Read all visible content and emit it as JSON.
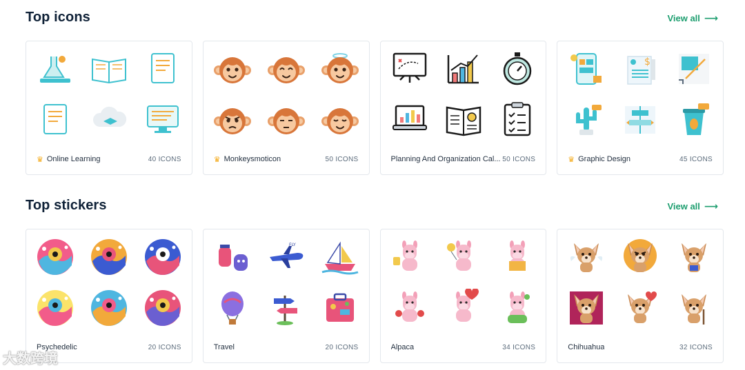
{
  "top_icons": {
    "title": "Top icons",
    "view_all": "View all",
    "cards": [
      {
        "name": "Online Learning",
        "count": "40 ICONS",
        "premium": true,
        "icons": [
          "flask-icon",
          "book-wifi-icon",
          "certificate-icon",
          "question-doc-icon",
          "cloud-cap-icon",
          "computer-doc-icon"
        ]
      },
      {
        "name": "Monkeysmoticon",
        "count": "50 ICONS",
        "premium": true,
        "icons": [
          "monkey-smile-icon",
          "monkey-happy-icon",
          "monkey-angel-icon",
          "monkey-angry-icon",
          "monkey-meh-icon",
          "monkey-sleepy-icon"
        ]
      },
      {
        "name": "Planning And Organization Cal...",
        "count": "50 ICONS",
        "premium": false,
        "icons": [
          "strategy-board-icon",
          "growth-chart-icon",
          "stopwatch-icon",
          "laptop-chart-icon",
          "report-book-icon",
          "checklist-icon"
        ]
      },
      {
        "name": "Graphic Design",
        "count": "45 ICONS",
        "premium": true,
        "icons": [
          "mobile-design-icon",
          "invoice-icon",
          "crop-tool-icon",
          "cactus-icon",
          "align-tool-icon",
          "coffee-cup-icon"
        ]
      }
    ]
  },
  "top_stickers": {
    "title": "Top stickers",
    "view_all": "View all",
    "cards": [
      {
        "name": "Psychedelic",
        "count": "20 ICONS",
        "premium": false,
        "icons": [
          "psychedelic-hand-icon",
          "psychedelic-face-icon",
          "psychedelic-eye-icon",
          "psychedelic-cup-icon",
          "psychedelic-box-icon",
          "psychedelic-rays-icon"
        ]
      },
      {
        "name": "Travel",
        "count": "20 ICONS",
        "premium": false,
        "icons": [
          "lantern-bag-icon",
          "airplane-icon",
          "sailboat-icon",
          "hot-air-balloon-icon",
          "signpost-icon",
          "suitcase-icon"
        ]
      },
      {
        "name": "Alpaca",
        "count": "34 ICONS",
        "premium": false,
        "icons": [
          "alpaca-thumbs-icon",
          "alpaca-balloon-icon",
          "alpaca-box-icon",
          "alpaca-boxing-icon",
          "alpaca-heartbreak-icon",
          "alpaca-bubbles-icon"
        ]
      },
      {
        "name": "Chihuahua",
        "count": "32 ICONS",
        "premium": false,
        "icons": [
          "chihuahua-angel-icon",
          "chihuahua-angry-icon",
          "chihuahua-happy-icon",
          "chihuahua-poster-icon",
          "chihuahua-love-icon",
          "chihuahua-old-icon"
        ]
      }
    ]
  },
  "watermark": "大数跨境",
  "colors": {
    "accent": "#1d9e6f",
    "crown": "#f3a712",
    "card_border": "#e3e7ec"
  }
}
